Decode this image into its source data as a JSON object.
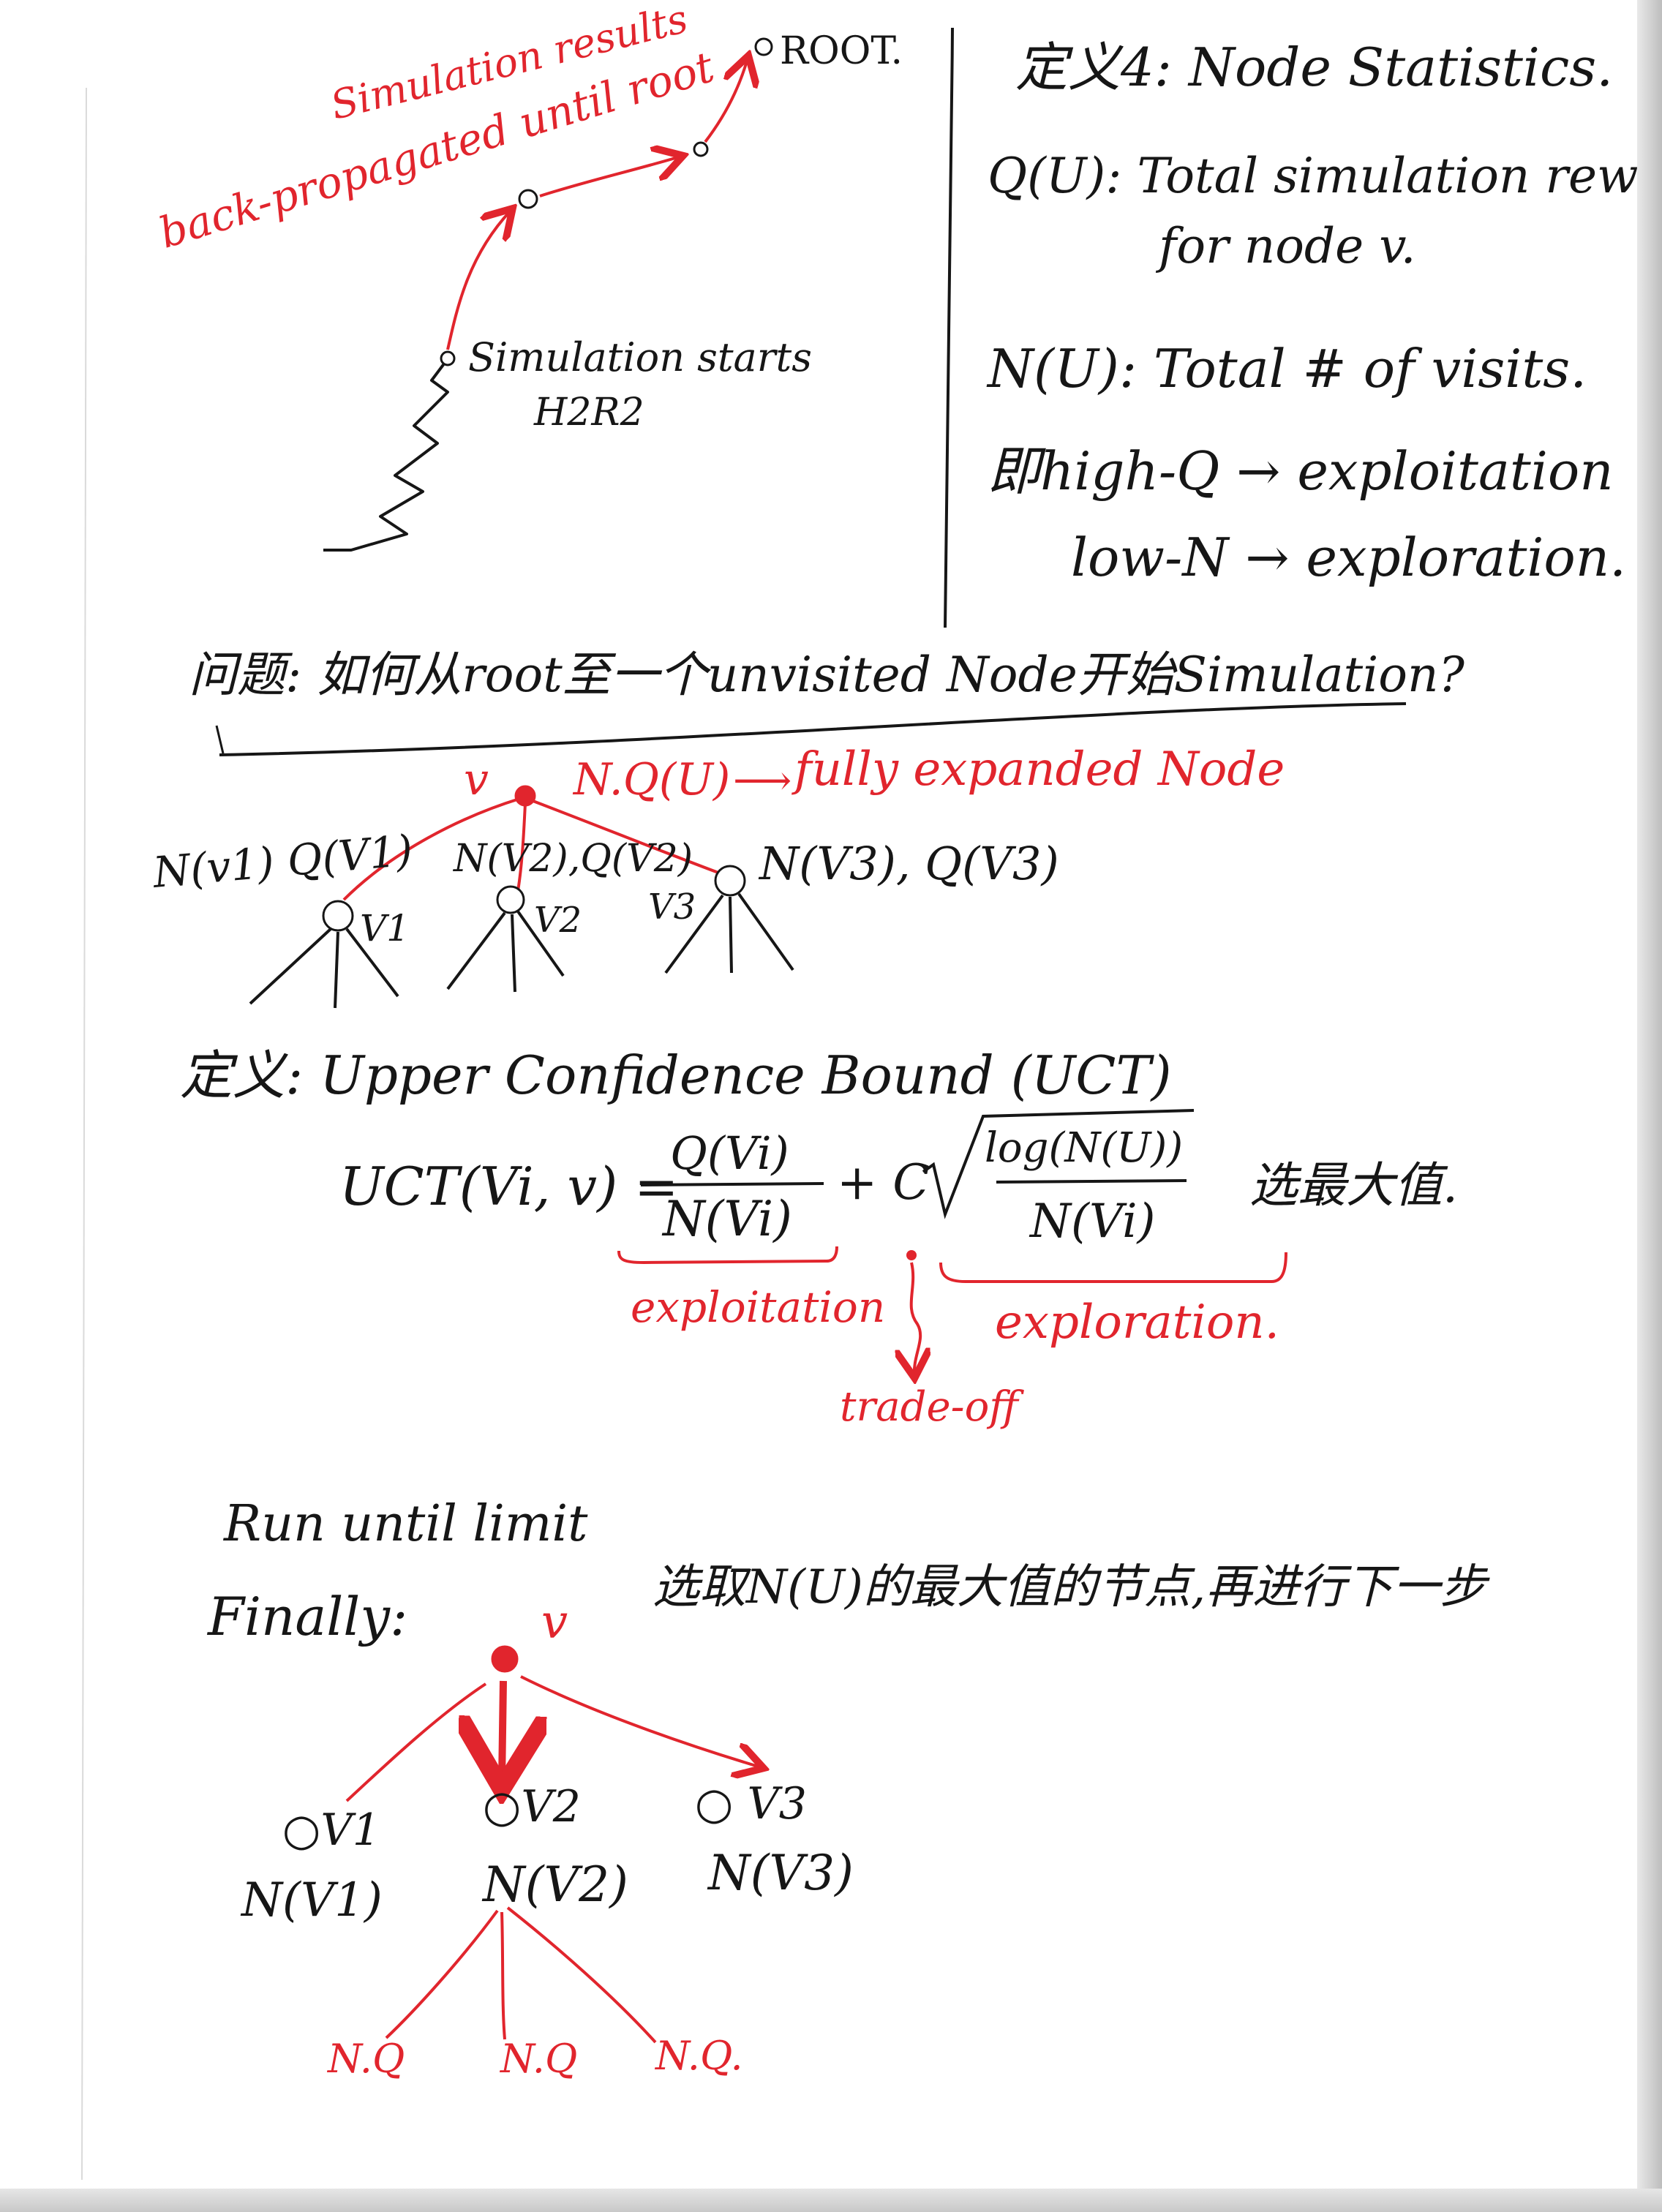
{
  "colors": {
    "ink": "#161616",
    "red_pen": "#e1252d",
    "paper": "#ffffff"
  },
  "diagram1": {
    "root_label": "ROOT.",
    "red_note_line1": "Simulation results",
    "red_note_line2": "back-propagated until root",
    "sim_label": "Simulation starts",
    "sim_label_2": "H2R2"
  },
  "definition4": {
    "title": "定义4: Node Statistics.",
    "q_line1": "Q(U): Total simulation reward",
    "q_line2": "for node v.",
    "n_line": "N(U): Total # of visits.",
    "hi_q": "即high-Q → exploitation",
    "low_n": "low-N → exploration."
  },
  "question": {
    "text": "问题: 如何从root至一个unvisited Node开始Simulation?"
  },
  "tree1": {
    "v_label": "v",
    "v_stats": "N.Q(U)",
    "arrow_note": "fully expanded Node",
    "child1_stats": "N(v1) Q(V1)",
    "child2_stats": "N(V2),Q(V2)",
    "child3_stats": "N(V3), Q(V3)",
    "child1_label": "V1",
    "child2_label": "V2",
    "child3_label": "V3"
  },
  "uct": {
    "title": "定义: Upper Confidence Bound (UCT)",
    "lhs": "UCT(Vi, v) =",
    "num": "Q(Vi)",
    "den": "N(Vi)",
    "plus_c": "+ C",
    "sqrt_num": "log(N(U))",
    "sqrt_den": "N(Vi)",
    "suffix": "选最大值.",
    "exploitation": "exploitation",
    "exploration": "exploration.",
    "tradeoff": "trade-off"
  },
  "finally": {
    "run_until": "Run until limit",
    "finally": "Finally:",
    "note": "选取N(U)的最大值的节点,再进行下一步",
    "v_label": "v",
    "c1_label": "V1",
    "c2_label": "V2",
    "c3_label": "V3",
    "c1_n": "N(V1)",
    "c2_n": "N(V2)",
    "c3_n": "N(V3)",
    "leaf1": "N.Q",
    "leaf2": "N.Q",
    "leaf3": "N.Q."
  }
}
